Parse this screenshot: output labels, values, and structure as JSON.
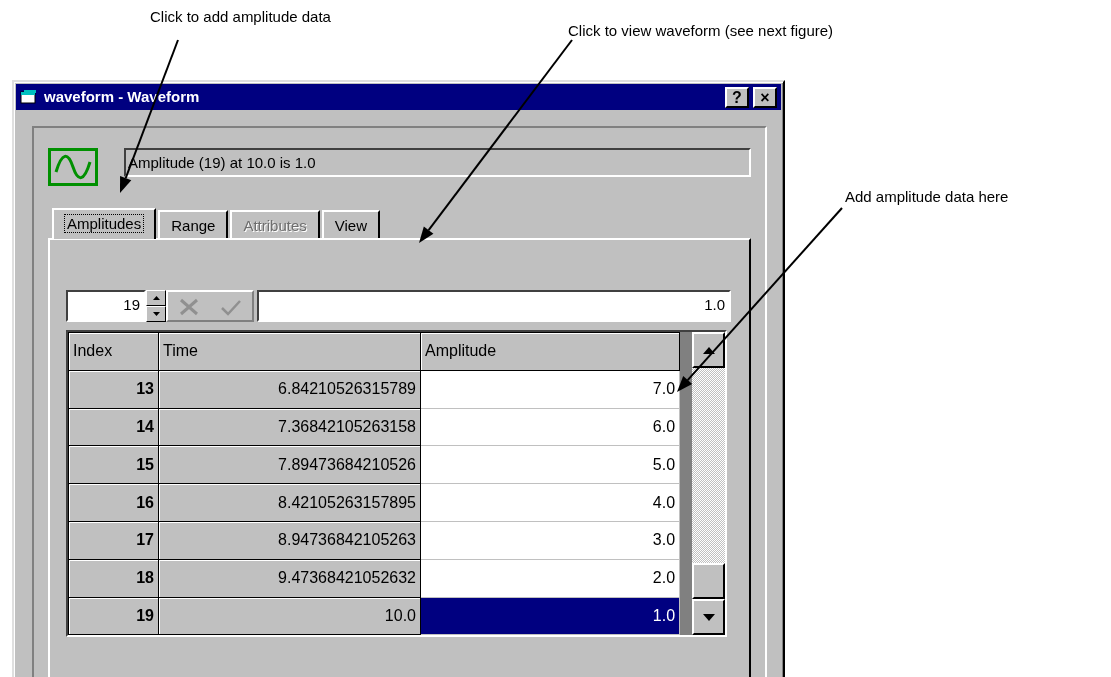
{
  "callouts": [
    {
      "text": "Click to add amplitude data"
    },
    {
      "text": "Click to view waveform (see next figure)"
    },
    {
      "text": "Add amplitude data here"
    }
  ],
  "window": {
    "title": "waveform - Waveform",
    "buttons": [
      "?",
      "×"
    ]
  },
  "status": "Amplitude (19) at 10.0 is 1.0",
  "tabs": [
    {
      "label": "Amplitudes",
      "selected": true,
      "disabled": false
    },
    {
      "label": "Range",
      "selected": false,
      "disabled": false
    },
    {
      "label": "Attributes",
      "selected": false,
      "disabled": true
    },
    {
      "label": "View",
      "selected": false,
      "disabled": false
    }
  ],
  "editor": {
    "index": "19",
    "value": "1.0",
    "buttons_disabled": true
  },
  "grid": {
    "columns": [
      "Index",
      "Time",
      "Amplitude"
    ],
    "rows": [
      {
        "index": "13",
        "time": "6.84210526315789",
        "amplitude": "7.0",
        "selected": false
      },
      {
        "index": "14",
        "time": "7.36842105263158",
        "amplitude": "6.0",
        "selected": false
      },
      {
        "index": "15",
        "time": "7.89473684210526",
        "amplitude": "5.0",
        "selected": false
      },
      {
        "index": "16",
        "time": "8.42105263157895",
        "amplitude": "4.0",
        "selected": false
      },
      {
        "index": "17",
        "time": "8.94736842105263",
        "amplitude": "3.0",
        "selected": false
      },
      {
        "index": "18",
        "time": "9.47368421052632",
        "amplitude": "2.0",
        "selected": false
      },
      {
        "index": "19",
        "time": "10.0",
        "amplitude": "1.0",
        "selected": true
      }
    ]
  }
}
